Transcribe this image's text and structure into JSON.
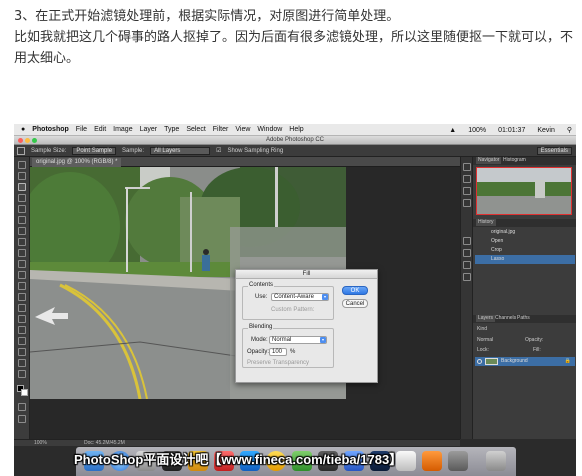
{
  "article": {
    "line1": "3、在正式开始滤镜处理前，根据实际情况，对原图进行简单处理。",
    "line2": "比如我就把这几个碍事的路人抠掉了。因为后面有很多滤镜处理，所以这里随便抠一下就可以，不用太细心。"
  },
  "macbar": {
    "app": "Photoshop",
    "menus": [
      "File",
      "Edit",
      "Image",
      "Layer",
      "Type",
      "Select",
      "Filter",
      "View",
      "Window",
      "Help"
    ],
    "battery": "100%",
    "clock": "01:01:37",
    "user": "Kevin"
  },
  "window": {
    "title": "Adobe Photoshop CC"
  },
  "options": {
    "sample_size_label": "Sample Size:",
    "sample_size_value": "Point Sample",
    "sample_label": "Sample:",
    "sample_value": "All Layers",
    "show_ring": "Show Sampling Ring",
    "workspace": "Essentials"
  },
  "document": {
    "tab": "original.jpg @ 100% (RGB/8) *"
  },
  "fill_dialog": {
    "title": "Fill",
    "contents_legend": "Contents",
    "use_label": "Use:",
    "use_value": "Content-Aware",
    "custom_pattern": "Custom Pattern:",
    "blending_legend": "Blending",
    "mode_label": "Mode:",
    "mode_value": "Normal",
    "opacity_label": "Opacity:",
    "opacity_value": "100",
    "opacity_unit": "%",
    "preserve_transparency": "Preserve Transparency",
    "ok": "OK",
    "cancel": "Cancel"
  },
  "panels": {
    "navigator_tab": "Navigator",
    "histogram_tab": "Histogram",
    "history_tab": "History",
    "history_items": [
      "original.jpg",
      "Open",
      "Crop",
      "Lasso"
    ],
    "layers_tab": "Layers",
    "channels_tab": "Channels",
    "paths_tab": "Paths",
    "kind_label": "Kind",
    "normal_label": "Normal",
    "opacity_label": "Opacity:",
    "lock_label": "Lock:",
    "fill_label": "Fill:",
    "layer_name": "Background"
  },
  "status": {
    "zoom": "100%",
    "doc": "Doc: 45.2M/45.2M"
  },
  "watermark": "PhotoShop平面设计吧【www.fineca.com/tieba/1783】",
  "colors": {
    "accent": "#4d8ef0",
    "ps_dark": "#3c3c3c",
    "history_selected": "#3c6ea5"
  }
}
